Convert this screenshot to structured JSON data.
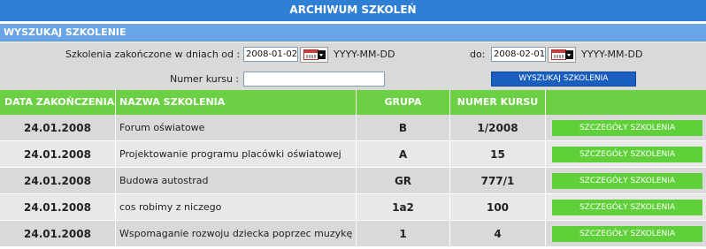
{
  "page_title": "ARCHIWUM SZKOLEŃ",
  "search": {
    "header": "WYSZUKAJ SZKOLENIE",
    "from_label": "Szkolenia zakończone w dniach od :",
    "from_value": "2008-01-02",
    "from_format": "YYYY-MM-DD",
    "to_label": "do:",
    "to_value": "2008-02-01",
    "to_format": "YYYY-MM-DD",
    "course_number_label": "Numer kursu :",
    "course_number_value": "",
    "search_button": "WYSZUKAJ SZKOLENIA"
  },
  "table": {
    "columns": [
      "DATA ZAKOŃCZENIA",
      "NAZWA SZKOLENIA",
      "GRUPA",
      "NUMER KURSU",
      ""
    ],
    "details_label": "SZCZEGÓŁY SZKOLENIA",
    "rows": [
      {
        "date": "24.01.2008",
        "name": "Forum oświatowe",
        "group": "B",
        "number": "1/2008"
      },
      {
        "date": "24.01.2008",
        "name": "Projektowanie programu placówki oświatowej",
        "group": "A",
        "number": "15"
      },
      {
        "date": "24.01.2008",
        "name": "Budowa autostrad",
        "group": "GR",
        "number": "777/1"
      },
      {
        "date": "24.01.2008",
        "name": "cos robimy z niczego",
        "group": "1a2",
        "number": "100"
      },
      {
        "date": "24.01.2008",
        "name": "Wspomaganie rozwoju dziecka poprzec muzykę",
        "group": "1",
        "number": "4"
      }
    ]
  },
  "colors": {
    "title_bar": "#2f7fd5",
    "search_header": "#6aa5e8",
    "table_header": "#6cd044",
    "details_button": "#5fd03a",
    "search_button": "#1a5fbf"
  }
}
